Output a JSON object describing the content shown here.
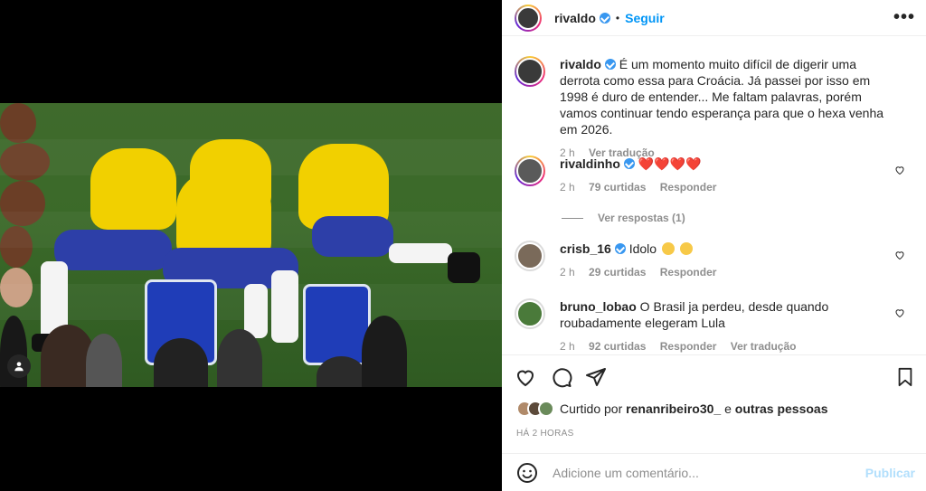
{
  "post": {
    "author": "rivaldo",
    "follow_label": "Seguir",
    "dot": "•",
    "more": "•••"
  },
  "comments": [
    {
      "user": "rivaldo",
      "text": "É um momento muito difícil de digerir uma derrota como essa para Croácia. Já passei por isso em 1998 é duro de entender... Me faltam palavras, porém vamos continuar tendo esperança para que o hexa venha em 2026.",
      "time": "2 h",
      "translate": "Ver tradução"
    },
    {
      "user": "rivaldinho",
      "text": "❤️❤️❤️❤️",
      "time": "2 h",
      "likes": "79 curtidas",
      "reply": "Responder",
      "view_replies": "Ver respostas (1)"
    },
    {
      "user": "crisb_16",
      "text": "Idolo",
      "time": "2 h",
      "likes": "29 curtidas",
      "reply": "Responder"
    },
    {
      "user": "bruno_lobao",
      "text": "O Brasil ja perdeu, desde quando roubadamente elegeram Lula",
      "time": "2 h",
      "likes": "92 curtidas",
      "reply": "Responder",
      "translate": "Ver tradução"
    }
  ],
  "likes": {
    "prefix": "Curtido por",
    "user": "renanribeiro30_",
    "conj": "e",
    "others": "outras pessoas"
  },
  "timestamp": "HÁ 2 HORAS",
  "add_comment": {
    "placeholder": "Adicione um comentário...",
    "publish": "Publicar"
  },
  "colors": {
    "accent": "#0095f6",
    "verified": "#3897f0",
    "heart": "#ed4956",
    "muted": "#8e8e8e"
  }
}
